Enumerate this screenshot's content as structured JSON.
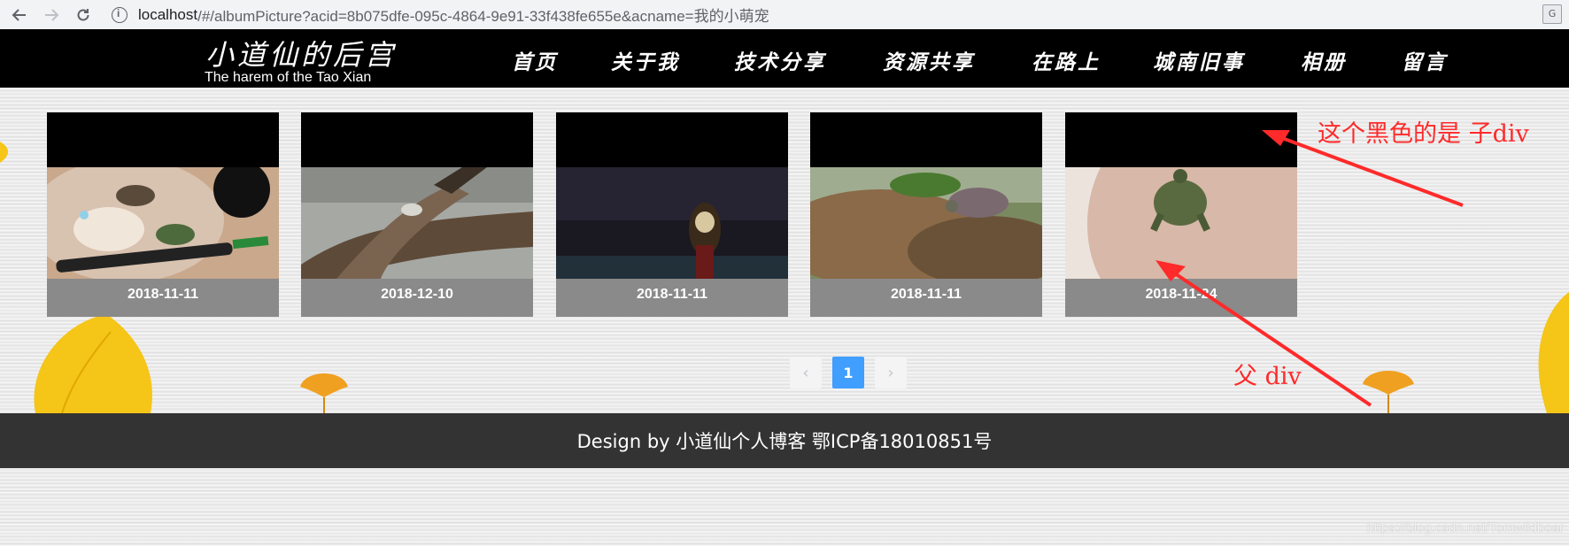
{
  "browser": {
    "url_host": "localhost",
    "url_path": "/#/albumPicture?acid=8b075dfe-095c-4864-9e91-33f438fe655e&acname=我的小萌宠",
    "icons": [
      "back-icon",
      "forward-icon",
      "reload-icon",
      "info-icon",
      "translate-icon"
    ]
  },
  "header": {
    "logo_title": "小道仙的后宫",
    "logo_subtitle": "The harem of the Tao Xian",
    "nav": [
      "首页",
      "关于我",
      "技术分享",
      "资源共享",
      "在路上",
      "城南旧事",
      "相册",
      "留言"
    ]
  },
  "album": {
    "cards": [
      {
        "date": "2018-11-11"
      },
      {
        "date": "2018-12-10"
      },
      {
        "date": "2018-11-11"
      },
      {
        "date": "2018-11-11"
      },
      {
        "date": "2018-11-24"
      }
    ]
  },
  "pagination": {
    "prev": "‹",
    "current": "1",
    "next": "›"
  },
  "footer": {
    "text": "Design by 小道仙个人博客 鄂ICP备18010851号"
  },
  "annotations": {
    "child_label": "这个黑色的是 子div",
    "parent_label": "父 div",
    "color": "#ff2a2a"
  },
  "watermark": "https://blog.csdn.net/Tomwildboar",
  "colors": {
    "header_bg": "#000000",
    "card_caption_bg": "#8a8a8a",
    "page_active": "#409eff",
    "footer_bg": "#333333"
  }
}
